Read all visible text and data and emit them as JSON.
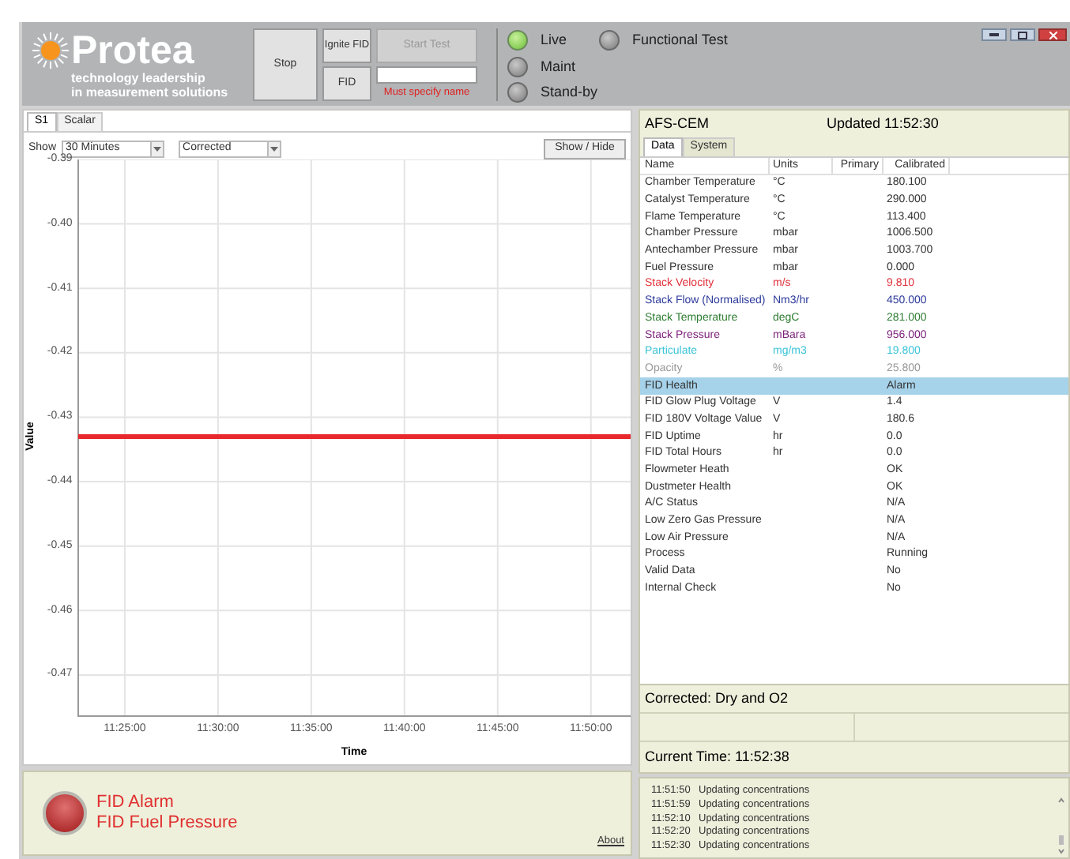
{
  "logo": {
    "name": "Protea",
    "tagline": [
      "technology leadership",
      "in measurement solutions"
    ]
  },
  "toolbar": {
    "stop": "Stop",
    "ignite": "Ignite FID",
    "fid": "FID",
    "start_test": {
      "label": "Start Test",
      "disabled": true
    },
    "error": "Must specify name"
  },
  "modes": [
    {
      "label": "Live",
      "selected": true
    },
    {
      "label": "Maint",
      "selected": false
    },
    {
      "label": "Stand-by",
      "selected": false
    },
    {
      "label": "Functional Test",
      "selected": false
    }
  ],
  "left_tabs": [
    {
      "label": "S1",
      "selected": true
    },
    {
      "label": "Scalar",
      "selected": false
    }
  ],
  "show_label": "Show",
  "range_select": "30 Minutes",
  "mode_select": "Corrected",
  "show_hide": "Show / Hide",
  "chart": {
    "chart_data": {
      "type": "line",
      "grid": true,
      "xlabel": "Time",
      "ylabel": "Value",
      "x": [
        40950,
        42738
      ],
      "series": [
        {
          "color": "#e8282c",
          "values": [
            -0.433,
            -0.433
          ]
        }
      ],
      "xlim": [
        40947.6,
        42738
      ],
      "ylim": [
        -0.4765,
        -0.39
      ],
      "xticks": [
        {
          "value": 41100,
          "label": "11:25:00"
        },
        {
          "value": 41400,
          "label": "11:30:00"
        },
        {
          "value": 41700,
          "label": "11:35:00"
        },
        {
          "value": 42000,
          "label": "11:40:00"
        },
        {
          "value": 42300,
          "label": "11:45:00"
        },
        {
          "value": 42600,
          "label": "11:50:00"
        }
      ],
      "yticks": [
        {
          "value": -0.39,
          "label": "-0.39"
        },
        {
          "value": -0.4,
          "label": "-0.40"
        },
        {
          "value": -0.41,
          "label": "-0.41"
        },
        {
          "value": -0.42,
          "label": "-0.42"
        },
        {
          "value": -0.43,
          "label": "-0.43"
        },
        {
          "value": -0.44,
          "label": "-0.44"
        },
        {
          "value": -0.45,
          "label": "-0.45"
        },
        {
          "value": -0.46,
          "label": "-0.46"
        },
        {
          "value": -0.47,
          "label": "-0.47"
        }
      ]
    }
  },
  "alarm": {
    "active": true,
    "lines": [
      "FID Alarm",
      "FID Fuel Pressure"
    ],
    "link": "About"
  },
  "right": {
    "title": "AFS-CEM",
    "updated": "Updated 11:52:30"
  },
  "right_tabs": [
    {
      "label": "Data",
      "selected": true
    },
    {
      "label": "System",
      "selected": false
    }
  ],
  "table": {
    "columns": [
      "Name",
      "Units",
      "Primary",
      "Calibrated"
    ],
    "rows": [
      {
        "name": "Chamber Temperature",
        "units": "°C",
        "calibrated": "180.100",
        "color": "#333333",
        "selected": false
      },
      {
        "name": "Catalyst Temperature",
        "units": "°C",
        "calibrated": "290.000",
        "color": "#333333",
        "selected": false
      },
      {
        "name": "Flame Temperature",
        "units": "°C",
        "calibrated": "113.400",
        "color": "#333333",
        "selected": false
      },
      {
        "name": "Chamber Pressure",
        "units": "mbar",
        "calibrated": "1006.500",
        "color": "#333333",
        "selected": false
      },
      {
        "name": "Antechamber Pressure",
        "units": "mbar",
        "calibrated": "1003.700",
        "color": "#333333",
        "selected": false
      },
      {
        "name": "Fuel Pressure",
        "units": "mbar",
        "calibrated": "0.000",
        "color": "#333333",
        "selected": false
      },
      {
        "name": "Stack Velocity",
        "units": "m/s",
        "calibrated": "9.810",
        "color": "#e0303a",
        "selected": false
      },
      {
        "name": "Stack Flow (Normalised)",
        "units": "Nm3/hr",
        "calibrated": "450.000",
        "color": "#2c3a9c",
        "selected": false
      },
      {
        "name": "Stack Temperature",
        "units": "degC",
        "calibrated": "281.000",
        "color": "#2e7d32",
        "selected": false
      },
      {
        "name": "Stack Pressure",
        "units": "mBara",
        "calibrated": "956.000",
        "color": "#7b1f7a",
        "selected": false
      },
      {
        "name": "Particulate",
        "units": "mg/m3",
        "calibrated": "19.800",
        "color": "#3cc4d8",
        "selected": false
      },
      {
        "name": "Opacity",
        "units": "%",
        "calibrated": "25.800",
        "color": "#999999",
        "selected": false
      },
      {
        "name": "FID Health",
        "units": "",
        "calibrated": "Alarm",
        "color": "#333333",
        "selected": true
      },
      {
        "name": "FID Glow Plug Voltage",
        "units": "V",
        "calibrated": "1.4",
        "color": "#333333",
        "selected": false
      },
      {
        "name": "FID 180V Voltage Value",
        "units": "V",
        "calibrated": "180.6",
        "color": "#333333",
        "selected": false
      },
      {
        "name": "FID Uptime",
        "units": "hr",
        "calibrated": "0.0",
        "color": "#333333",
        "selected": false
      },
      {
        "name": "FID Total Hours",
        "units": "hr",
        "calibrated": "0.0",
        "color": "#333333",
        "selected": false
      },
      {
        "name": "Flowmeter Heath",
        "units": "",
        "calibrated": "OK",
        "color": "#333333",
        "selected": false
      },
      {
        "name": "Dustmeter Health",
        "units": "",
        "calibrated": "OK",
        "color": "#333333",
        "selected": false
      },
      {
        "name": "A/C Status",
        "units": "",
        "calibrated": "N/A",
        "color": "#333333",
        "selected": false
      },
      {
        "name": "Low Zero Gas Pressure",
        "units": "",
        "calibrated": "N/A",
        "color": "#333333",
        "selected": false
      },
      {
        "name": "Low Air Pressure",
        "units": "",
        "calibrated": "N/A",
        "color": "#333333",
        "selected": false
      },
      {
        "name": "Process",
        "units": "",
        "calibrated": "Running",
        "color": "#333333",
        "selected": false
      },
      {
        "name": "Valid Data",
        "units": "",
        "calibrated": "No",
        "color": "#333333",
        "selected": false
      },
      {
        "name": "Internal Check",
        "units": "",
        "calibrated": "No",
        "color": "#333333",
        "selected": false
      }
    ]
  },
  "corrected": "Corrected: Dry and O2",
  "current_time": "Current Time: 11:52:38",
  "log": [
    {
      "time": "11:51:50",
      "message": "Updating concentrations"
    },
    {
      "time": "11:51:59",
      "message": "Updating concentrations"
    },
    {
      "time": "11:52:10",
      "message": "Updating concentrations"
    },
    {
      "time": "11:52:20",
      "message": "Updating concentrations"
    },
    {
      "time": "11:52:30",
      "message": "Updating concentrations"
    }
  ]
}
